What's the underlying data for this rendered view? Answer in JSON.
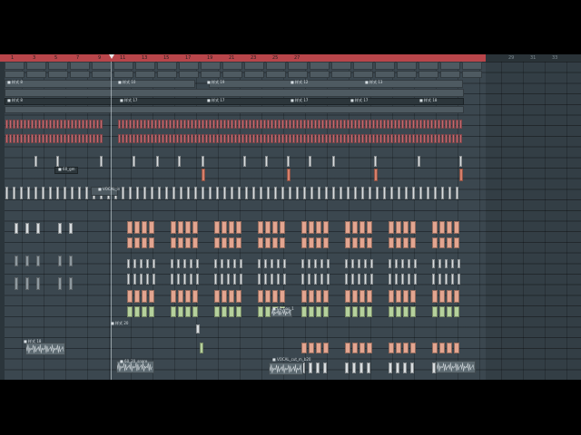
{
  "ruler": {
    "bars_red": [
      "1",
      "3",
      "5",
      "7",
      "9",
      "11",
      "13",
      "15",
      "17",
      "19",
      "21",
      "23",
      "25",
      "27"
    ],
    "bars_grey": [
      "29",
      "31",
      "33"
    ]
  },
  "clip_labels": {
    "pattern_a": "■ 样式 8",
    "pattern_b": "■ 样式 10",
    "pattern_c": "■ 样式 12",
    "pattern_d": "■ 样式 13",
    "pattern_e": "■ 样式 17",
    "pattern_f": "■ 样式 18",
    "pattern_g": "■ 样式 19",
    "pattern_h": "■ 样式 20",
    "audio_a": "■ 60_gm",
    "audio_b": "■ 60_bas_1",
    "audio_c": "■ 60_20_snare",
    "audio_d": "■ VOCAL_in",
    "audio_e": "■ VOCAL_cut_m_b20"
  },
  "colors": {
    "background": "#3b474f",
    "ruler_active": "#b8454a",
    "clip_red": "#c36a70",
    "clip_salmon": "#e3a590",
    "clip_green": "#b5d19c"
  }
}
